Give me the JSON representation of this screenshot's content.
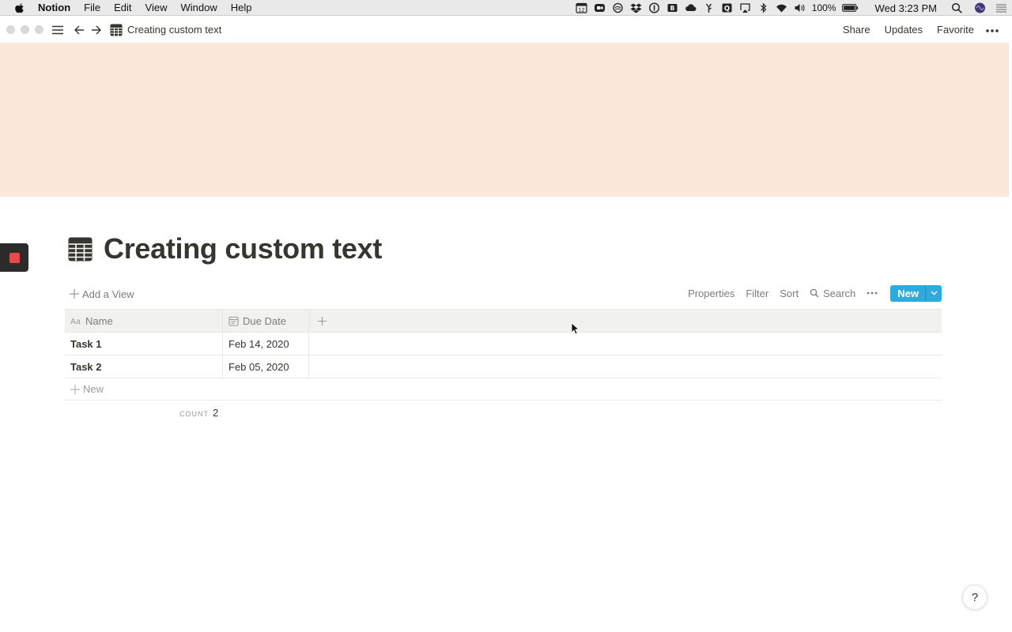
{
  "menubar": {
    "items": [
      "Notion",
      "File",
      "Edit",
      "View",
      "Window",
      "Help"
    ],
    "battery": "100%",
    "clock": "Wed 3:23 PM",
    "status_icons": [
      "calendar-icon",
      "zoom-icon",
      "sync-icon",
      "dropbox-icon",
      "info-icon",
      "bear-icon",
      "cloud-icon",
      "fork-icon",
      "q-icon",
      "airplay-icon",
      "bluetooth-icon",
      "wifi-icon",
      "volume-icon",
      "battery-icon",
      "search-icon",
      "siri-icon",
      "list-icon"
    ],
    "calendar_day": "12"
  },
  "window": {
    "breadcrumb_title": "Creating custom text",
    "actions": {
      "share": "Share",
      "updates": "Updates",
      "favorite": "Favorite"
    }
  },
  "colors": {
    "cover": "#fbe8da",
    "accent": "#2eaadc",
    "text": "#37352f",
    "muted": "#7d7c78"
  },
  "page": {
    "title": "Creating custom text",
    "add_view": "Add a View",
    "controls": {
      "properties": "Properties",
      "filter": "Filter",
      "sort": "Sort",
      "search": "Search",
      "new": "New"
    },
    "table": {
      "columns": [
        {
          "label": "Name",
          "icon": "text-property-icon"
        },
        {
          "label": "Due Date",
          "icon": "calendar-property-icon"
        }
      ],
      "rows": [
        {
          "name": "Task 1",
          "due": "Feb 14, 2020"
        },
        {
          "name": "Task 2",
          "due": "Feb 05, 2020"
        }
      ],
      "new_row": "New",
      "count_label": "COUNT",
      "count_value": "2"
    },
    "help": "?"
  }
}
